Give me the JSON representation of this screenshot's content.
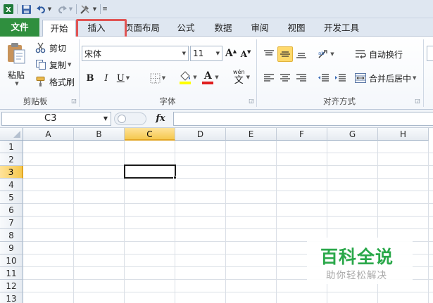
{
  "tabs": {
    "file": "文件",
    "home": "开始",
    "insert": "插入",
    "page_layout": "页面布局",
    "formulas": "公式",
    "data": "数据",
    "review": "审阅",
    "view": "视图",
    "developer": "开发工具"
  },
  "clipboard": {
    "paste": "粘贴",
    "cut": "剪切",
    "copy": "复制",
    "format_painter": "格式刷",
    "group_label": "剪贴板"
  },
  "font": {
    "font_name": "宋体",
    "font_size": "11",
    "bold": "B",
    "italic": "I",
    "underline": "U",
    "grow": "A",
    "shrink": "A",
    "font_color_letter": "A",
    "phonetic_top": "wén",
    "phonetic_char": "文",
    "group_label": "字体"
  },
  "alignment": {
    "wrap_text": "自动换行",
    "merge_center": "合并后居中",
    "group_label": "对齐方式"
  },
  "formula_bar": {
    "name_box": "C3",
    "fx": "fx"
  },
  "grid": {
    "columns": [
      "A",
      "B",
      "C",
      "D",
      "E",
      "F",
      "G",
      "H"
    ],
    "rows": [
      "1",
      "2",
      "3",
      "4",
      "5",
      "6",
      "7",
      "8",
      "9",
      "10",
      "11",
      "12",
      "13"
    ],
    "active_column": "C",
    "active_row": "3"
  },
  "watermark": {
    "title": "百科全说",
    "subtitle": "助你轻松解决"
  },
  "colors": {
    "file_tab": "#2f8f3e",
    "highlight_box": "#e05454",
    "active_header": "#f5c84e",
    "watermark": "#2aa84a"
  }
}
